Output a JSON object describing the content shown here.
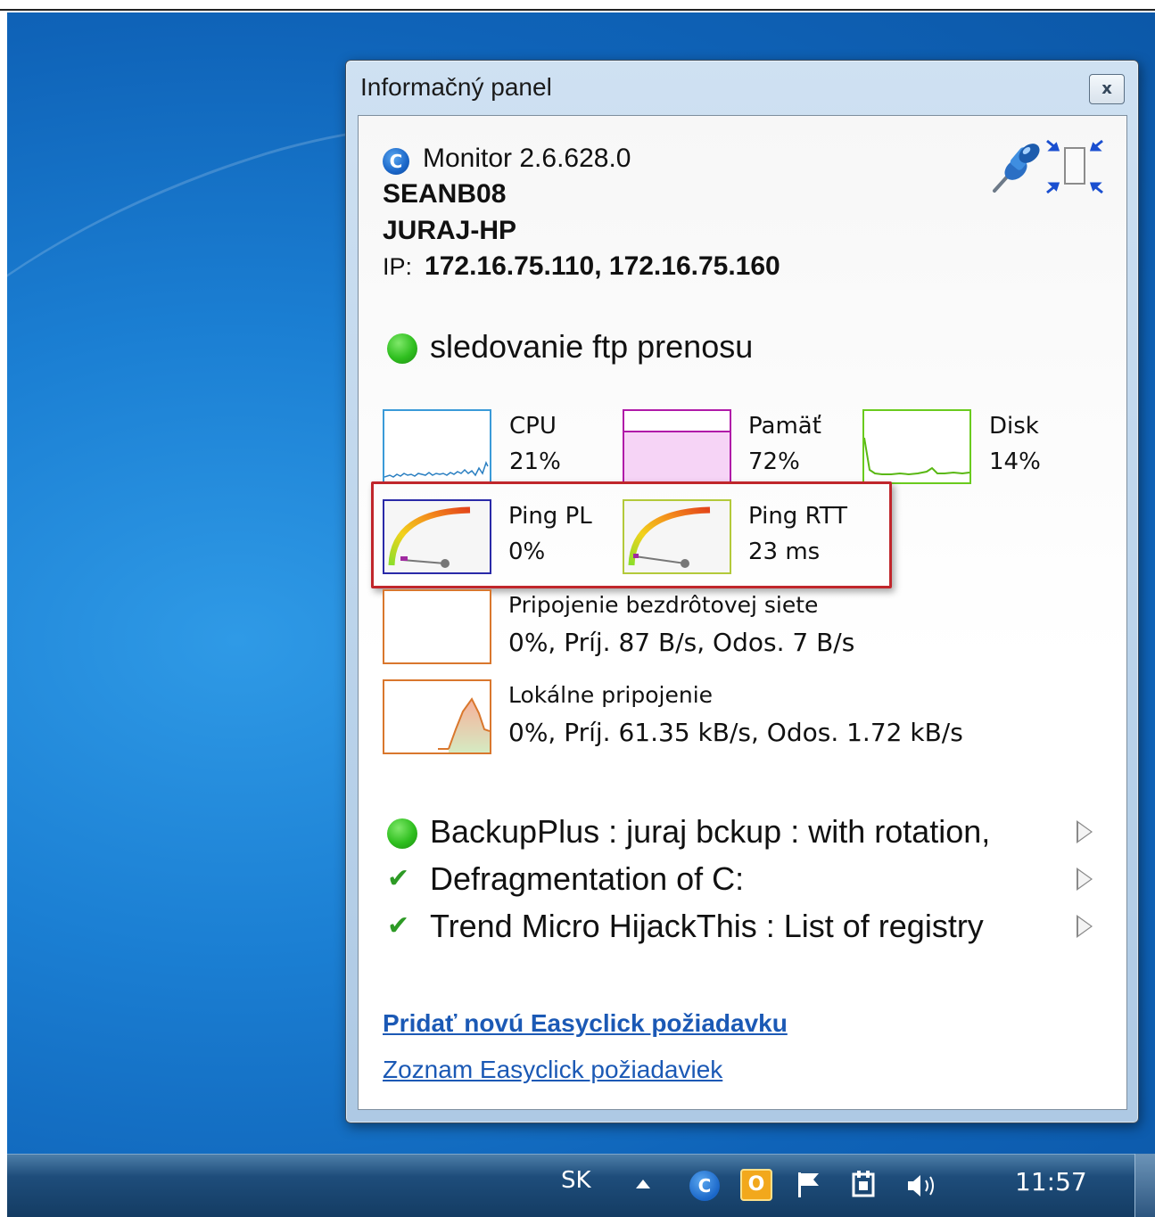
{
  "window": {
    "title": "Informačný panel",
    "close_glyph": "x"
  },
  "header": {
    "app_icon_letter": "C",
    "app_name": "Monitor 2.6.628.0",
    "host_1": "SEANB08",
    "host_2": "JURAJ-HP",
    "ip_label": "IP:",
    "ip_value": "172.16.75.110, 172.16.75.160",
    "icons": [
      "pin-icon",
      "compact-view-icon"
    ]
  },
  "status": {
    "text": "sledovanie ftp prenosu",
    "color": "#2fbf1f"
  },
  "metrics": {
    "cpu": {
      "name": "CPU",
      "value": "21%"
    },
    "memory": {
      "name": "Pamäť",
      "value": "72%"
    },
    "disk": {
      "name": "Disk",
      "value": "14%"
    },
    "ping_pl": {
      "name": "Ping PL",
      "value": "0%"
    },
    "ping_rtt": {
      "name": "Ping RTT",
      "value": "23 ms"
    },
    "wifi": {
      "name": "Pripojenie bezdrôtovej siete",
      "value": "0%, Príj. 87 B/s, Odos. 7 B/s"
    },
    "lan": {
      "name": "Lokálne pripojenie",
      "value": "0%, Príj. 61.35 kB/s, Odos. 1.72 kB/s"
    }
  },
  "tasks": [
    {
      "status": "running",
      "text": "BackupPlus : juraj bckup : with rotation,"
    },
    {
      "status": "done",
      "text": "Defragmentation of C:"
    },
    {
      "status": "done",
      "text": "Trend Micro HijackThis : List of registry"
    }
  ],
  "links": {
    "add_request": "Pridať novú Easyclick požiadavku",
    "request_list": "Zoznam Easyclick požiadaviek"
  },
  "taskbar": {
    "language": "SK",
    "clock": "11:57",
    "tray_icons": [
      "show-hidden-icons-icon",
      "monitor-tray-icon",
      "outlook-tray-icon",
      "action-center-flag-icon",
      "power-icon",
      "volume-icon"
    ]
  },
  "colors": {
    "cpu_border": "#3a9ad8",
    "memory_border": "#b01aa8",
    "disk_border": "#6acb1e",
    "network_border": "#d9772d",
    "highlight": "#c0262b",
    "link": "#1b59b5"
  }
}
